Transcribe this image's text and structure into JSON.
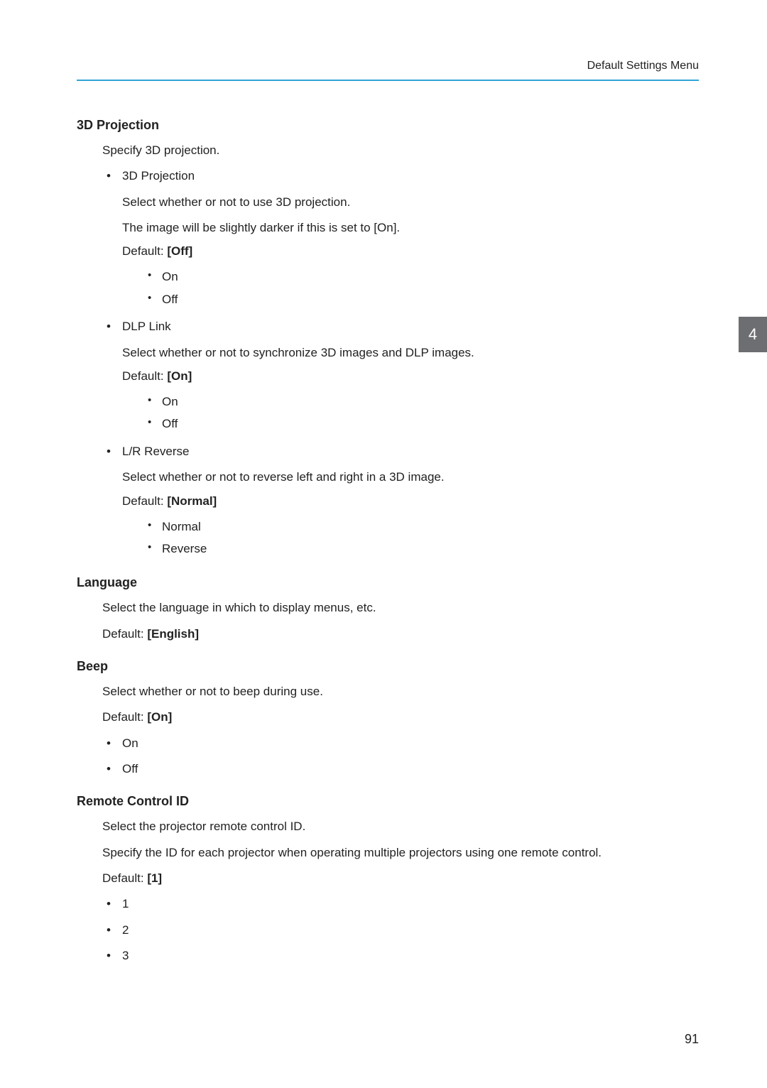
{
  "header": {
    "running_head": "Default Settings Menu"
  },
  "side_tab": "4",
  "page_number": "91",
  "sections": {
    "s3d": {
      "title": "3D Projection",
      "intro": "Specify 3D projection.",
      "items": {
        "proj": {
          "label": "3D Projection",
          "desc1": "Select whether or not to use 3D projection.",
          "desc2": "The image will be slightly darker if this is set to [On].",
          "default_label": "Default: ",
          "default_value": "[Off]",
          "opts": {
            "o1": "On",
            "o2": "Off"
          }
        },
        "dlp": {
          "label": "DLP Link",
          "desc1": "Select whether or not to synchronize 3D images and DLP images.",
          "default_label": "Default: ",
          "default_value": "[On]",
          "opts": {
            "o1": "On",
            "o2": "Off"
          }
        },
        "lr": {
          "label": "L/R Reverse",
          "desc1": "Select whether or not to reverse left and right in a 3D image.",
          "default_label": "Default: ",
          "default_value": "[Normal]",
          "opts": {
            "o1": "Normal",
            "o2": "Reverse"
          }
        }
      }
    },
    "lang": {
      "title": "Language",
      "desc": "Select the language in which to display menus, etc.",
      "default_label": "Default: ",
      "default_value": "[English]"
    },
    "beep": {
      "title": "Beep",
      "desc": "Select whether or not to beep during use.",
      "default_label": "Default: ",
      "default_value": "[On]",
      "opts": {
        "o1": "On",
        "o2": "Off"
      }
    },
    "rcid": {
      "title": "Remote Control ID",
      "desc1": "Select the projector remote control ID.",
      "desc2": "Specify the ID for each projector when operating multiple projectors using one remote control.",
      "default_label": "Default: ",
      "default_value": "[1]",
      "opts": {
        "o1": "1",
        "o2": "2",
        "o3": "3"
      }
    }
  }
}
